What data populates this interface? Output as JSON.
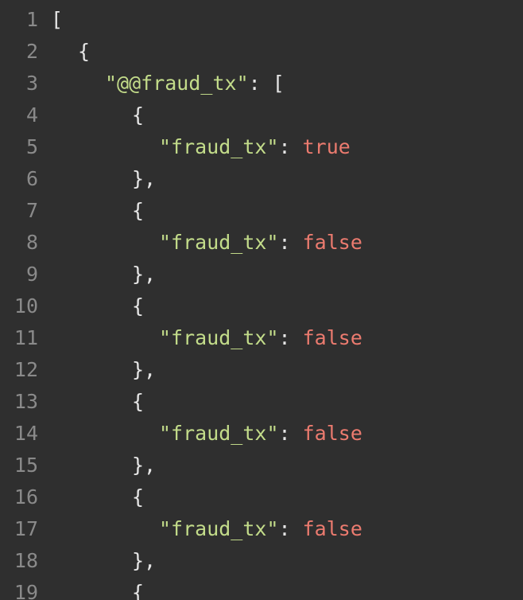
{
  "lines": [
    {
      "num": "1",
      "punct": "["
    },
    {
      "num": "2",
      "punct": "{"
    },
    {
      "num": "3",
      "key": "\"@@fraud_tx\"",
      "sep": ": ",
      "punct": "["
    },
    {
      "num": "4",
      "punct": "{"
    },
    {
      "num": "5",
      "key": "\"fraud_tx\"",
      "sep": ": ",
      "value": "true"
    },
    {
      "num": "6",
      "punct": "},"
    },
    {
      "num": "7",
      "punct": "{"
    },
    {
      "num": "8",
      "key": "\"fraud_tx\"",
      "sep": ": ",
      "value": "false"
    },
    {
      "num": "9",
      "punct": "},"
    },
    {
      "num": "10",
      "punct": "{"
    },
    {
      "num": "11",
      "key": "\"fraud_tx\"",
      "sep": ": ",
      "value": "false"
    },
    {
      "num": "12",
      "punct": "},"
    },
    {
      "num": "13",
      "punct": "{"
    },
    {
      "num": "14",
      "key": "\"fraud_tx\"",
      "sep": ": ",
      "value": "false"
    },
    {
      "num": "15",
      "punct": "},"
    },
    {
      "num": "16",
      "punct": "{"
    },
    {
      "num": "17",
      "key": "\"fraud_tx\"",
      "sep": ": ",
      "value": "false"
    },
    {
      "num": "18",
      "punct": "},"
    },
    {
      "num": "19",
      "punct": "{"
    }
  ],
  "colors": {
    "background": "#2f2f2f",
    "string": "#c3dc8a",
    "boolean": "#ec7b6f",
    "line_number": "#8a8a8a"
  }
}
